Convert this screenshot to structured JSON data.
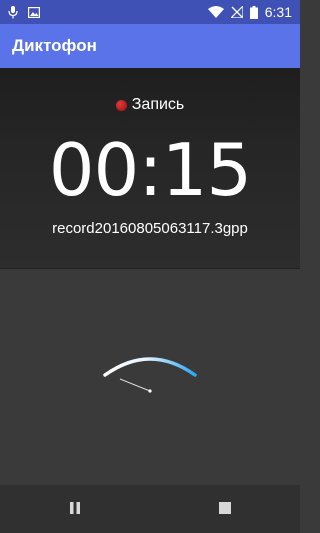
{
  "status_bar": {
    "time": "6:31",
    "icons": [
      "microphone-icon",
      "image-icon",
      "wifi-icon",
      "no-signal-icon",
      "battery-icon"
    ]
  },
  "app_bar": {
    "title": "Диктофон",
    "background": "#5b73e8"
  },
  "recorder": {
    "status_label": "Запись",
    "elapsed": "00:15",
    "filename": "record20160805063117.3gpp",
    "indicator_color": "#d32f2f"
  },
  "level_meter": {
    "icon": "vu-meter-icon",
    "accent": "#29a8f5"
  },
  "controls": {
    "pause_icon": "pause-icon",
    "stop_icon": "stop-icon"
  }
}
